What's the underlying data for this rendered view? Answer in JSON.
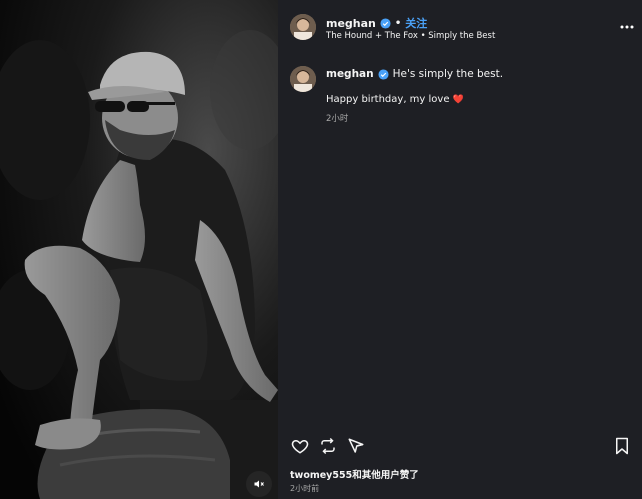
{
  "post": {
    "author": "meghan",
    "separator": "•",
    "follow_label": "关注",
    "audio_line": "The Hound + The Fox • Simply the Best"
  },
  "caption": {
    "author": "meghan",
    "text": "He's simply the best.",
    "line2": "Happy birthday, my love",
    "heart": "❤️",
    "time": "2小时"
  },
  "footer": {
    "likes_text": "twomey555和其他用户赞了",
    "time": "2小时前"
  },
  "colors": {
    "panel_bg": "#1e1f24",
    "accent": "#4aa1f7",
    "heart": "#e8466b",
    "muted_text": "#a8a8a8"
  },
  "icons": {
    "more": "more-icon",
    "verified": "verified-badge-icon",
    "like": "heart-outline-icon",
    "repost": "repost-icon",
    "share": "send-icon",
    "save": "bookmark-icon",
    "mute": "speaker-muted-icon"
  }
}
